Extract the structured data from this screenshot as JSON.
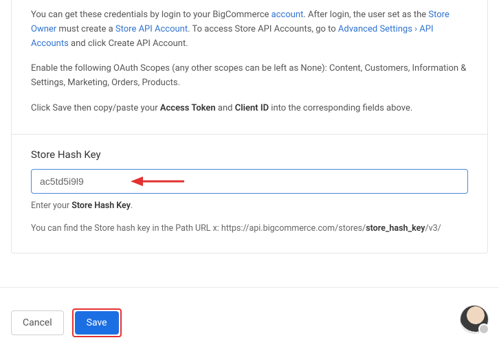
{
  "instructions": {
    "p1_a": "You can get these credentials by login to your BigCommerce ",
    "p1_link1": "account",
    "p1_b": ". After login, the user set as the ",
    "p1_link2": "Store Owner",
    "p1_c": " must create a ",
    "p1_link3": "Store API Account",
    "p1_d": ". To access Store API Accounts, go to ",
    "p1_link4": "Advanced Settings › API Accounts",
    "p1_e": " and click Create API Account.",
    "p2": "Enable the following OAuth Scopes (any other scopes can be left as None): Content, Customers, Information & Settings, Marketing, Orders, Products.",
    "p3_a": "Click Save then copy/paste your ",
    "p3_bold1": "Access Token",
    "p3_b": " and ",
    "p3_bold2": "Client ID",
    "p3_c": " into the corresponding fields above."
  },
  "field": {
    "label": "Store Hash Key",
    "value": "ac5td5i9l9",
    "helper_a": "Enter your ",
    "helper_bold": "Store Hash Key",
    "helper_b": ".",
    "find_a": "You can find the Store hash key in the Path URL x: https://api.bigcommerce.com/stores/",
    "find_bold": "store_hash_key",
    "find_b": "/v3/"
  },
  "footer": {
    "cancel": "Cancel",
    "save": "Save"
  }
}
